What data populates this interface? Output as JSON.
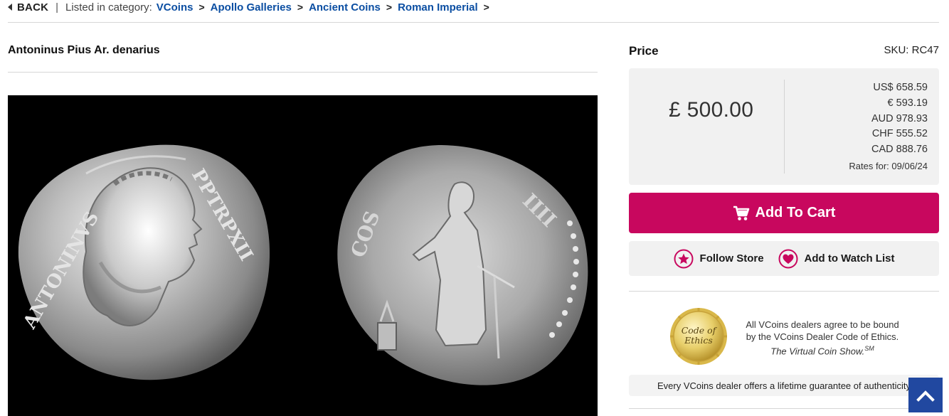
{
  "breadcrumb": {
    "back_label": "BACK",
    "separator": "|",
    "listed_label": "Listed in category:",
    "links": [
      {
        "label": "VCoins"
      },
      {
        "label": "Apollo Galleries"
      },
      {
        "label": "Ancient Coins"
      },
      {
        "label": "Roman Imperial"
      }
    ],
    "arrow": ">"
  },
  "product": {
    "title": "Antoninus Pius Ar. denarius",
    "image_icon": "coin-photo"
  },
  "price": {
    "heading": "Price",
    "sku": "SKU: RC47",
    "main": "£ 500.00",
    "rates": [
      {
        "label": "US$ 658.59"
      },
      {
        "label": "€ 593.19"
      },
      {
        "label": "AUD 978.93"
      },
      {
        "label": "CHF 555.52"
      },
      {
        "label": "CAD 888.76"
      }
    ],
    "rates_date": "Rates for: 09/06/24"
  },
  "actions": {
    "add_to_cart": "Add To Cart",
    "cart_icon": "shopping-cart-icon",
    "follow_store": "Follow Store",
    "watch_list": "Add to Watch List",
    "accent_color": "#c8075e"
  },
  "ethics": {
    "seal_line1": "Code of",
    "seal_line2": "Ethics",
    "line1": "All VCoins dealers agree to be bound",
    "line2": "by the VCoins Dealer Code of Ethics.",
    "line3": "The Virtual Coin Show.",
    "line3_mark": "SM"
  },
  "guarantee": {
    "text": "Every VCoins dealer offers a lifetime guarantee of authenticity"
  },
  "scroll_top": {
    "icon": "chevron-up-icon",
    "color": "#2148a0"
  }
}
